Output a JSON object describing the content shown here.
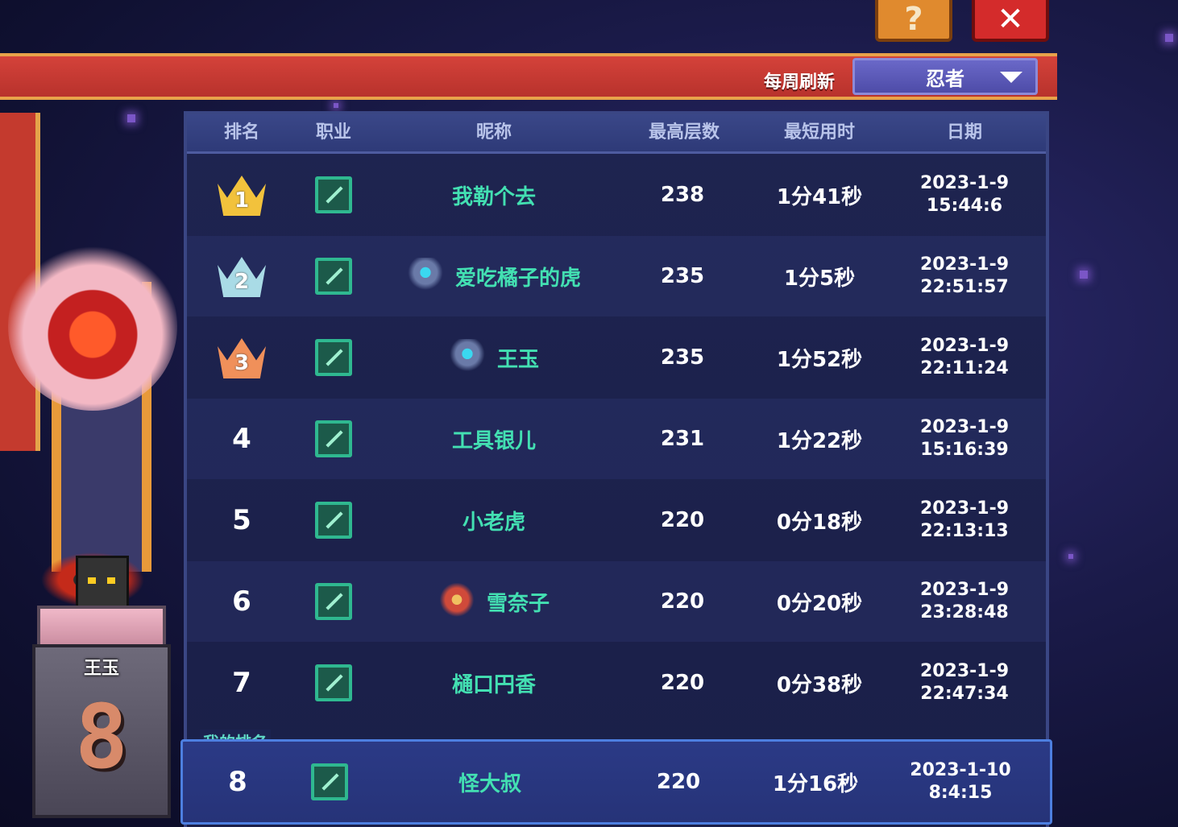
{
  "header": {
    "weekly_refresh": "每周刷新",
    "class_select": {
      "value": "忍者",
      "icon": "chevron-down-icon"
    },
    "help_icon": "?",
    "close_icon": "✕"
  },
  "table": {
    "columns": [
      "排名",
      "职业",
      "昵称",
      "最高层数",
      "最短用时",
      "日期"
    ],
    "rows": [
      {
        "rank": "1",
        "crown": "gold",
        "avatar": "",
        "name": "我勒个去",
        "floor": "238",
        "time": "1分41秒",
        "date": "2023-1-9",
        "clock": "15:44:6"
      },
      {
        "rank": "2",
        "crown": "silver",
        "avatar": "spider",
        "name": "爱吃橘子的虎",
        "floor": "235",
        "time": "1分5秒",
        "date": "2023-1-9",
        "clock": "22:51:57"
      },
      {
        "rank": "3",
        "crown": "bronze",
        "avatar": "spider",
        "name": "王玉",
        "floor": "235",
        "time": "1分52秒",
        "date": "2023-1-9",
        "clock": "22:11:24"
      },
      {
        "rank": "4",
        "crown": "",
        "avatar": "",
        "name": "工具银儿",
        "floor": "231",
        "time": "1分22秒",
        "date": "2023-1-9",
        "clock": "15:16:39"
      },
      {
        "rank": "5",
        "crown": "",
        "avatar": "",
        "name": "小老虎",
        "floor": "220",
        "time": "0分18秒",
        "date": "2023-1-9",
        "clock": "22:13:13"
      },
      {
        "rank": "6",
        "crown": "",
        "avatar": "robot",
        "name": "雪奈子",
        "floor": "220",
        "time": "0分20秒",
        "date": "2023-1-9",
        "clock": "23:28:48"
      },
      {
        "rank": "7",
        "crown": "",
        "avatar": "",
        "name": "樋口円香",
        "floor": "220",
        "time": "0分38秒",
        "date": "2023-1-9",
        "clock": "22:47:34"
      }
    ],
    "my_rank": {
      "label": "我的排名",
      "rank": "8",
      "name": "怪大叔",
      "floor": "220",
      "time": "1分16秒",
      "date": "2023-1-10",
      "clock": "8:4:15"
    }
  },
  "showcase": {
    "player_name": "王玉",
    "rank": "8"
  },
  "colors": {
    "gold": "#f2c23c",
    "silver": "#a9dbe6",
    "bronze": "#f0905a",
    "name_green": "#43e0b2",
    "banner_red": "#c43a32",
    "accent_blue": "#4d7fe0"
  }
}
